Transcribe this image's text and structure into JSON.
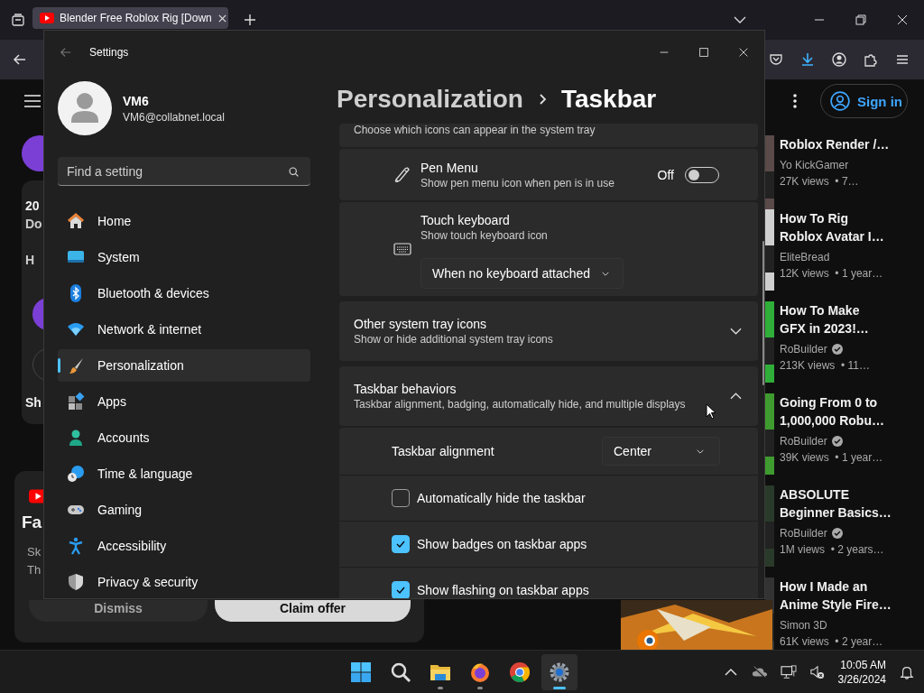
{
  "browser": {
    "tab": {
      "title": "Blender Free Roblox Rig [Down",
      "selected": true
    }
  },
  "youtube": {
    "sign_in": "Sign in",
    "card_fragments": [
      "20",
      "Do",
      "H",
      "Sh"
    ],
    "promo": {
      "title": "Fa",
      "lines": [
        "Sk",
        "Th"
      ],
      "dismiss": "Dismiss",
      "claim": "Claim offer"
    },
    "videos": [
      {
        "title_lines": [
          "Roblox Render /…"
        ],
        "channel": "Yo KickGamer",
        "verified": false,
        "meta": "27K views  • 7…"
      },
      {
        "title_lines": [
          "How To Rig",
          "Roblox Avatar I…"
        ],
        "channel": "EliteBread",
        "verified": false,
        "meta": "12K views  • 1 year…"
      },
      {
        "title_lines": [
          "How To Make",
          "GFX in 2023!…"
        ],
        "channel": "RoBuilder",
        "verified": true,
        "meta": "213K views  • 11…"
      },
      {
        "title_lines": [
          "Going From 0 to",
          "1,000,000 Robu…"
        ],
        "channel": "RoBuilder",
        "verified": true,
        "meta": "39K views  • 1 year…"
      },
      {
        "title_lines": [
          "ABSOLUTE",
          "Beginner Basics…"
        ],
        "channel": "RoBuilder",
        "verified": true,
        "meta": "1M views  • 2 years…"
      },
      {
        "title_lines": [
          "How I Made an",
          "Anime Style Fire…"
        ],
        "channel": "Simon 3D",
        "verified": false,
        "meta": "61K views  • 2 year…"
      }
    ]
  },
  "settings": {
    "title": "Settings",
    "user": {
      "name": "VM6",
      "email": "VM6@collabnet.local"
    },
    "search": {
      "placeholder": "Find a setting"
    },
    "nav": [
      {
        "label": "Home",
        "selected": false
      },
      {
        "label": "System",
        "selected": false
      },
      {
        "label": "Bluetooth & devices",
        "selected": false
      },
      {
        "label": "Network & internet",
        "selected": false
      },
      {
        "label": "Personalization",
        "selected": true
      },
      {
        "label": "Apps",
        "selected": false
      },
      {
        "label": "Accounts",
        "selected": false
      },
      {
        "label": "Time & language",
        "selected": false
      },
      {
        "label": "Gaming",
        "selected": false
      },
      {
        "label": "Accessibility",
        "selected": false
      },
      {
        "label": "Privacy & security",
        "selected": false
      }
    ],
    "breadcrumb": [
      "Personalization",
      "Taskbar"
    ],
    "tray_hint": "Choose which icons can appear in the system tray",
    "pen_menu": {
      "title": "Pen Menu",
      "description": "Show pen menu icon when pen is in use",
      "state_label": "Off",
      "on": false
    },
    "touch_keyboard": {
      "title": "Touch keyboard",
      "description": "Show touch keyboard icon",
      "value": "When no keyboard attached"
    },
    "sections": [
      {
        "title": "Other system tray icons",
        "description": "Show or hide additional system tray icons",
        "expanded": false
      },
      {
        "title": "Taskbar behaviors",
        "description": "Taskbar alignment, badging, automatically hide, and multiple displays",
        "expanded": true,
        "alignment": {
          "label": "Taskbar alignment",
          "value": "Center"
        },
        "options": [
          {
            "label": "Automatically hide the taskbar",
            "checked": false
          },
          {
            "label": "Show badges on taskbar apps",
            "checked": true
          },
          {
            "label": "Show flashing on taskbar apps",
            "checked": true
          }
        ]
      }
    ]
  },
  "taskbar": {
    "apps": [
      {
        "running": false,
        "selected": false
      },
      {
        "running": false,
        "selected": false
      },
      {
        "running": true,
        "selected": false
      },
      {
        "running": true,
        "selected": false
      },
      {
        "running": false,
        "selected": false
      },
      {
        "running": true,
        "selected": true
      }
    ],
    "clock": {
      "time": "10:05 AM",
      "date": "3/26/2024"
    }
  }
}
